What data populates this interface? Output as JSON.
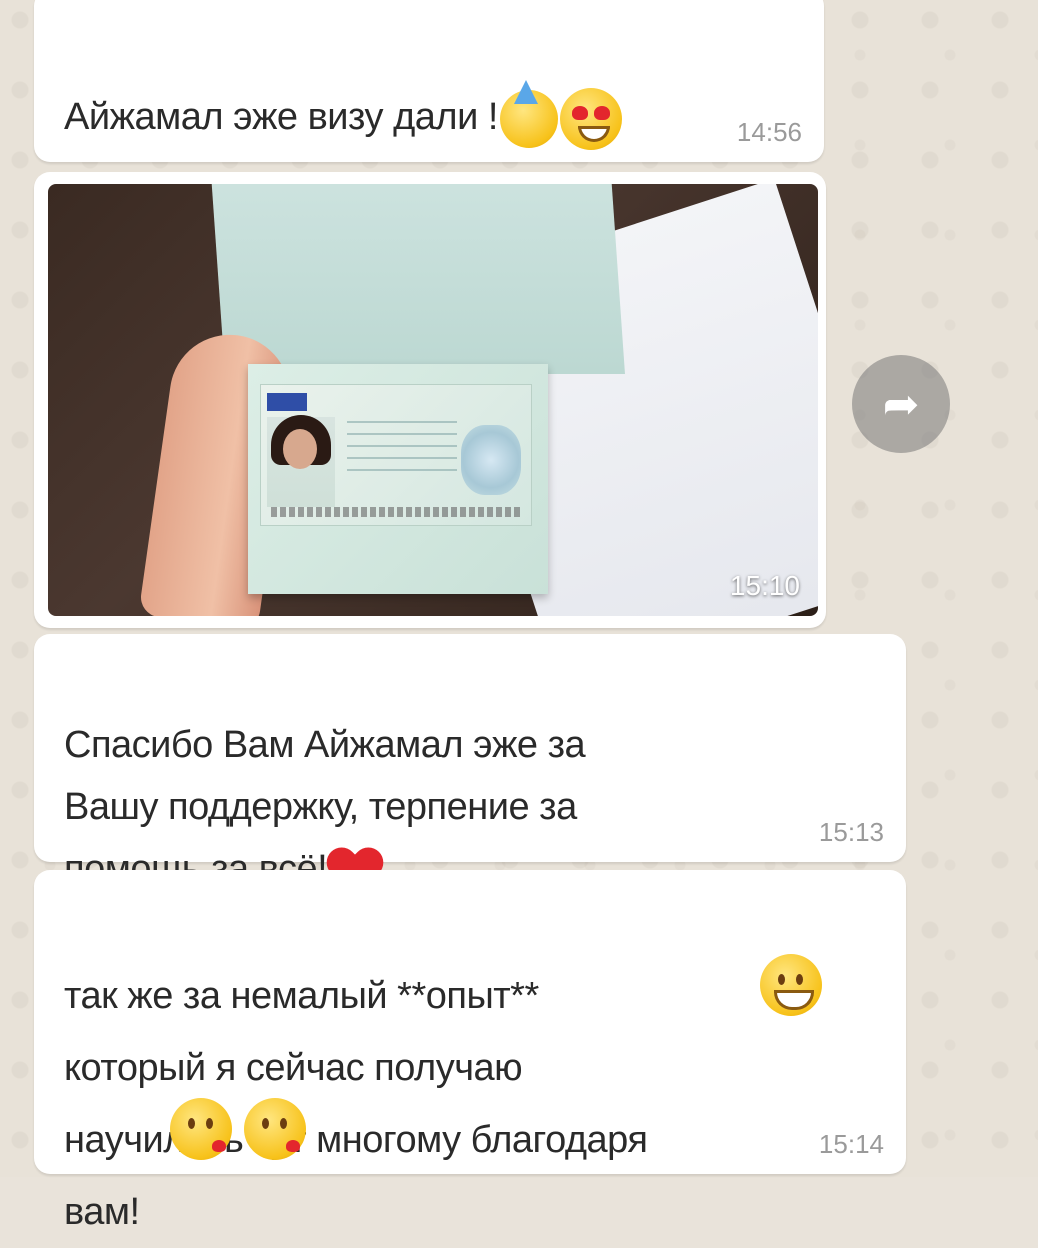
{
  "messages": [
    {
      "text": "Айжамал эже  визу дали !",
      "emojis": [
        "party-face-emoji",
        "heart-eyes-emoji"
      ],
      "time": "14:56"
    },
    {
      "type": "photo",
      "image_description": "passport with visa",
      "time": "15:10"
    },
    {
      "text": "Спасибо  Вам  Айжамал эже за\nВашу поддержку, терпение  за\nпомощь за всё!",
      "emojis": [
        "red-heart-emoji"
      ],
      "time": "15:13"
    },
    {
      "text": "так же  за немалый  **опыт**\nкоторый  я  сейчас  получаю\nнаучилась  тут многому благодаря\nвам!",
      "emojis": [
        "grinning-face-emoji",
        "kissing-face-emoji",
        "kissing-face-emoji"
      ],
      "time": "15:14"
    }
  ],
  "colors": {
    "bubble": "#ffffff",
    "background": "#e8e2d8",
    "timestamp": "#9a9a9a",
    "heart": "#e3262d"
  },
  "forward_button": {
    "icon": "forward-arrow-icon"
  }
}
